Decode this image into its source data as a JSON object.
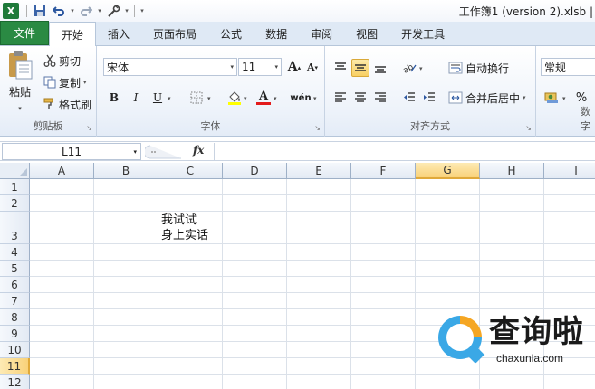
{
  "window": {
    "title": "工作簿1 (version 2).xlsb |",
    "logo_letter": "X"
  },
  "qat": {
    "icons": [
      "save-icon",
      "undo-icon",
      "redo-icon",
      "tool-icon"
    ]
  },
  "tabs": [
    {
      "label": "文件"
    },
    {
      "label": "开始"
    },
    {
      "label": "插入"
    },
    {
      "label": "页面布局"
    },
    {
      "label": "公式"
    },
    {
      "label": "数据"
    },
    {
      "label": "审阅"
    },
    {
      "label": "视图"
    },
    {
      "label": "开发工具"
    }
  ],
  "ribbon": {
    "clipboard": {
      "paste_label": "粘贴",
      "cut_label": "剪切",
      "copy_label": "复制",
      "format_painter_label": "格式刷",
      "group_label": "剪贴板"
    },
    "font": {
      "font_name": "宋体",
      "font_size": "11",
      "grow_label": "A",
      "shrink_label": "A",
      "bold_label": "B",
      "italic_label": "I",
      "underline_label": "U",
      "font_color_label": "A",
      "phonetic_label": "wén",
      "group_label": "字体"
    },
    "alignment": {
      "wrap_label": "自动换行",
      "merge_label": "合并后居中",
      "group_label": "对齐方式"
    },
    "number": {
      "format": "常规",
      "percent_label": "%",
      "group_label": "数字"
    }
  },
  "formula_bar": {
    "name_box": "L11",
    "fx_label": "fx",
    "value": ""
  },
  "grid": {
    "columns": [
      "A",
      "B",
      "C",
      "D",
      "E",
      "F",
      "G",
      "H",
      "I"
    ],
    "rows": [
      "1",
      "2",
      "3",
      "4",
      "5",
      "6",
      "7",
      "8",
      "9",
      "10",
      "11",
      "12"
    ],
    "selected_column": "G",
    "selected_row": "11",
    "cells": {
      "C3": "我试试\n身上实话"
    }
  },
  "watermark": {
    "text": "查询啦",
    "sub": "chaxunla.com"
  },
  "colors": {
    "file_tab": "#2a8a43",
    "selection_header": "#f9d27a",
    "header_border": "#9eb0c7"
  }
}
